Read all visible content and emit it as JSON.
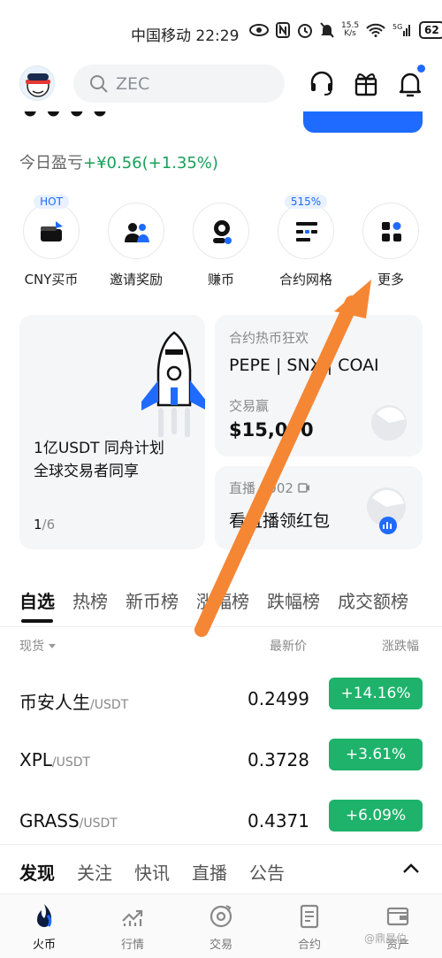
{
  "status_bar": {
    "carrier_time": "中国移动 22:29",
    "speed_top": "15.5",
    "speed_bottom": "K/s",
    "battery": "62"
  },
  "header": {
    "search_placeholder": "ZEC",
    "icons": [
      "headset-icon",
      "gift-icon",
      "bell-icon"
    ]
  },
  "balance": {
    "pnl_label": "今日盈亏",
    "pnl_value": "+¥0.56(+1.35%)"
  },
  "shortcuts": [
    {
      "label": "CNY买币",
      "tag": "HOT"
    },
    {
      "label": "邀请奖励",
      "tag": ""
    },
    {
      "label": "赚币",
      "tag": ""
    },
    {
      "label": "合约网格",
      "tag": "515%"
    },
    {
      "label": "更多",
      "tag": ""
    }
  ],
  "banners": {
    "main": {
      "title_line1": "1亿USDT 同舟计划",
      "title_line2": "全球交易者同享",
      "page_current": "1",
      "page_total": "/6"
    },
    "top_right": {
      "subtitle": "合约热币狂欢",
      "coins": "PEPE | SNX | COAI",
      "subtitle2": "交易赢",
      "amount": "$15,000"
    },
    "bottom_right": {
      "subtitle": "直播 · 002",
      "main": "看直播领红包"
    }
  },
  "market_tabs": [
    "自选",
    "热榜",
    "新币榜",
    "涨幅榜",
    "跌幅榜",
    "成交额榜"
  ],
  "columns": {
    "left": "现货",
    "middle": "最新价",
    "right": "涨跌幅"
  },
  "rows": [
    {
      "base": "币安人生",
      "quote": "/USDT",
      "price": "0.2499",
      "change": "+14.16%"
    },
    {
      "base": "XPL",
      "quote": "/USDT",
      "price": "0.3728",
      "change": "+3.61%"
    },
    {
      "base": "GRASS",
      "quote": "/USDT",
      "price": "0.4371",
      "change": "+6.09%"
    }
  ],
  "discover_tabs": [
    "发现",
    "关注",
    "快讯",
    "直播",
    "公告"
  ],
  "bottom_nav": [
    {
      "label": "火币",
      "icon": "huobi-flame-icon"
    },
    {
      "label": "行情",
      "icon": "market-chart-icon"
    },
    {
      "label": "交易",
      "icon": "trade-icon"
    },
    {
      "label": "合约",
      "icon": "contract-icon"
    },
    {
      "label": "资产",
      "icon": "wallet-icon"
    }
  ],
  "watermark": "@鼎晨伯",
  "colors": {
    "accent": "#1f6bff",
    "up": "#1fb26b",
    "arrow": "#f58634"
  }
}
